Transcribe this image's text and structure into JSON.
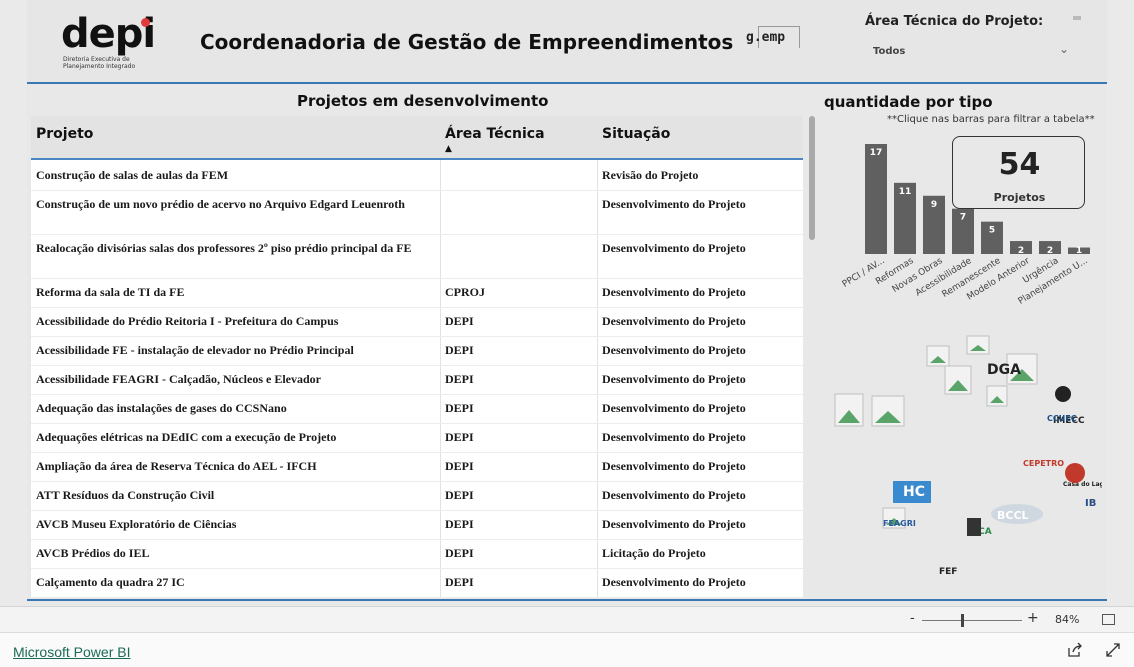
{
  "header": {
    "logo_text": "depi",
    "logo_subtitle_1": "Diretoria Executiva de",
    "logo_subtitle_2": "Planejamento Integrado",
    "title": "Coordenadoria de Gestão de Empreendimentos",
    "gemp_logo_text": "g.emp",
    "slicer_label": "Área Técnica do Projeto:",
    "slicer_value": "Todos"
  },
  "table": {
    "title": "Projetos em desenvolvimento",
    "columns": [
      "Projeto",
      "Área Técnica",
      "Situação"
    ],
    "sorted_column": "Área Técnica",
    "rows": [
      {
        "projeto": "Construção de salas de aulas da FEM",
        "area": "",
        "situacao": "Revisão do Projeto"
      },
      {
        "projeto": "Construção de um novo prédio de acervo no Arquivo Edgard Leuenroth",
        "area": "",
        "situacao": "Desenvolvimento do Projeto"
      },
      {
        "projeto": "Realocação divisórias salas dos professores 2º piso prédio principal da FE",
        "area": "",
        "situacao": "Desenvolvimento do Projeto"
      },
      {
        "projeto": "Reforma da sala de TI da FE",
        "area": "CPROJ",
        "situacao": "Desenvolvimento do Projeto"
      },
      {
        "projeto": "Acessibilidade do Prédio Reitoria I - Prefeitura do Campus",
        "area": "DEPI",
        "situacao": "Desenvolvimento do Projeto"
      },
      {
        "projeto": "Acessibilidade FE - instalação de elevador no Prédio Principal",
        "area": "DEPI",
        "situacao": "Desenvolvimento do Projeto"
      },
      {
        "projeto": "Acessibilidade FEAGRI - Calçadão, Núcleos e Elevador",
        "area": "DEPI",
        "situacao": "Desenvolvimento do Projeto"
      },
      {
        "projeto": "Adequação das instalações de gases do CCSNano",
        "area": "DEPI",
        "situacao": "Desenvolvimento do Projeto"
      },
      {
        "projeto": "Adequações elétricas na DEdIC com a execução de Projeto",
        "area": "DEPI",
        "situacao": "Desenvolvimento do Projeto"
      },
      {
        "projeto": "Ampliação da área de Reserva Técnica do AEL - IFCH",
        "area": "DEPI",
        "situacao": "Desenvolvimento do Projeto"
      },
      {
        "projeto": "ATT Resíduos da Construção Civil",
        "area": "DEPI",
        "situacao": "Desenvolvimento do Projeto"
      },
      {
        "projeto": "AVCB Museu Exploratório de Ciências",
        "area": "DEPI",
        "situacao": "Desenvolvimento do Projeto"
      },
      {
        "projeto": "AVCB Prédios do IEL",
        "area": "DEPI",
        "situacao": "Licitação do Projeto"
      },
      {
        "projeto": "Calçamento da quadra 27 IC",
        "area": "DEPI",
        "situacao": "Desenvolvimento do Projeto"
      }
    ]
  },
  "chart_data": {
    "type": "bar",
    "title": "quantidade por tipo",
    "subtitle": "**Clique nas barras para filtrar a tabela**",
    "categories": [
      "PPCI / AV...",
      "Reformas",
      "Novas Obras",
      "Acessibilidade",
      "Remanescente",
      "Modelo Anterior",
      "Urgência",
      "Planejamento U..."
    ],
    "values": [
      17,
      11,
      9,
      7,
      5,
      2,
      2,
      1
    ],
    "bar_color": "#606060",
    "label_color": "#ffffff",
    "ylim": [
      0,
      17
    ]
  },
  "kpi": {
    "value": "54",
    "label": "Projetos"
  },
  "logos": {
    "labels": [
      "DGA",
      "IMECC",
      "CCUEC",
      "CEPETRO",
      "Casa do Lago",
      "IB",
      "BCCL",
      "FEAGRI",
      "FEF",
      "FCA",
      "HC"
    ]
  },
  "footer": {
    "zoom_minus": "-",
    "zoom_plus": "+",
    "zoom_level": "84%",
    "zoom_fraction": 0.4,
    "powerbi_link": "Microsoft Power BI"
  }
}
